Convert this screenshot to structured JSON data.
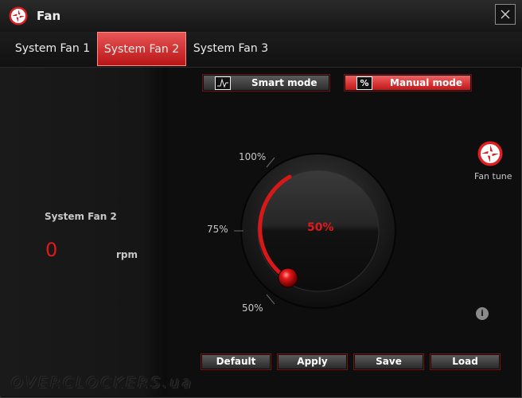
{
  "window": {
    "title": "Fan",
    "logo_icon": "msi-dragon-icon",
    "close_icon": "close-icon"
  },
  "tabs": [
    {
      "label": "System Fan 1",
      "active": false
    },
    {
      "label": "System Fan 2",
      "active": true
    },
    {
      "label": "System Fan 3",
      "active": false
    }
  ],
  "status": {
    "fan_name": "System Fan 2",
    "speed": "0",
    "unit": "rpm"
  },
  "modes": {
    "smart": {
      "label": "Smart mode",
      "icon": "curve-graph-icon"
    },
    "manual": {
      "label": "Manual mode",
      "icon": "percent-icon",
      "selected": true
    }
  },
  "knob": {
    "value_label": "50%",
    "value_percent": 50,
    "scale_labels": [
      "100%",
      "75%",
      "50%"
    ]
  },
  "fan_tune": {
    "label": "Fan tune",
    "icon": "fan-tune-icon"
  },
  "info_icon": "info-icon",
  "buttons": {
    "default": "Default",
    "apply": "Apply",
    "save": "Save",
    "load": "Load"
  },
  "watermark": "OVERCLOCKERS.ua",
  "colors": {
    "accent": "#e01a1a",
    "background": "#101010",
    "active_tab": "#d32f2f"
  }
}
